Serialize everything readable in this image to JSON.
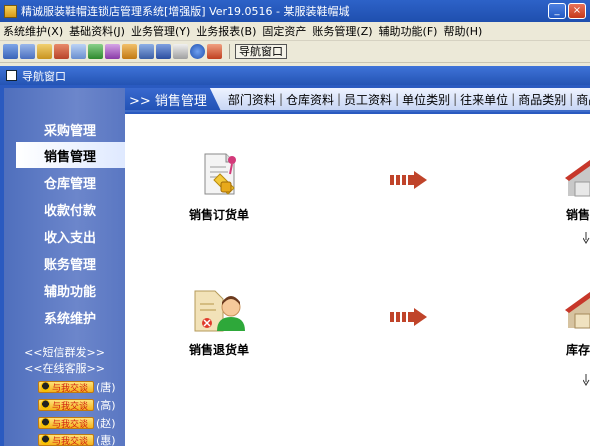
{
  "window": {
    "title": "精诚服装鞋帽连锁店管理系统[增强版] Ver19.0516 - 某服装鞋帽城",
    "minimize_label": "_",
    "maximize_label": "□",
    "close_label": "×"
  },
  "menubar": {
    "items": [
      {
        "label": "系统维护(X)"
      },
      {
        "label": "基础资料(J)"
      },
      {
        "label": "业务管理(Y)"
      },
      {
        "label": "业务报表(B)"
      },
      {
        "label": "固定资产"
      },
      {
        "label": "账务管理(Z)"
      },
      {
        "label": "辅助功能(F)"
      },
      {
        "label": "帮助(H)"
      }
    ]
  },
  "toolbar": {
    "nav_window_label": "导航窗口"
  },
  "inner_window": {
    "title": "导航窗口"
  },
  "sidebar": {
    "items": [
      {
        "label": "采购管理"
      },
      {
        "label": "销售管理"
      },
      {
        "label": "仓库管理"
      },
      {
        "label": "收款付款"
      },
      {
        "label": "收入支出"
      },
      {
        "label": "账务管理"
      },
      {
        "label": "辅助功能"
      },
      {
        "label": "系统维护"
      }
    ],
    "active_index": 1,
    "sms_link": "<<短信群发>>",
    "service_link": "<<在线客服>>",
    "qq_contacts": [
      {
        "badge": "与我交谈",
        "name": "(唐)"
      },
      {
        "badge": "与我交谈",
        "name": "(高)"
      },
      {
        "badge": "与我交谈",
        "name": "(赵)"
      },
      {
        "badge": "与我交谈",
        "name": "(惠)"
      }
    ]
  },
  "tabs": {
    "active_label": ">> 销售管理",
    "links": [
      {
        "label": "部门资料"
      },
      {
        "label": "仓库资料"
      },
      {
        "label": "员工资料"
      },
      {
        "label": "单位类别"
      },
      {
        "label": "往来单位"
      },
      {
        "label": "商品类别"
      },
      {
        "label": "商品资料"
      }
    ],
    "separator": "|"
  },
  "modules": {
    "sales_order": {
      "label": "销售订货单",
      "icon": "sales-order-document-icon"
    },
    "sales_return": {
      "label": "销售退货单",
      "icon": "sales-return-person-icon"
    },
    "sales_out_partial": {
      "label": "销售",
      "icon": "house-icon"
    },
    "stock_partial": {
      "label": "库存",
      "icon": "house-icon"
    }
  },
  "colors": {
    "titlebar": "#2455b8",
    "sidebar": "#5d78c4",
    "tab_active": "#2e5fc4",
    "arrow": "#c0442a"
  }
}
